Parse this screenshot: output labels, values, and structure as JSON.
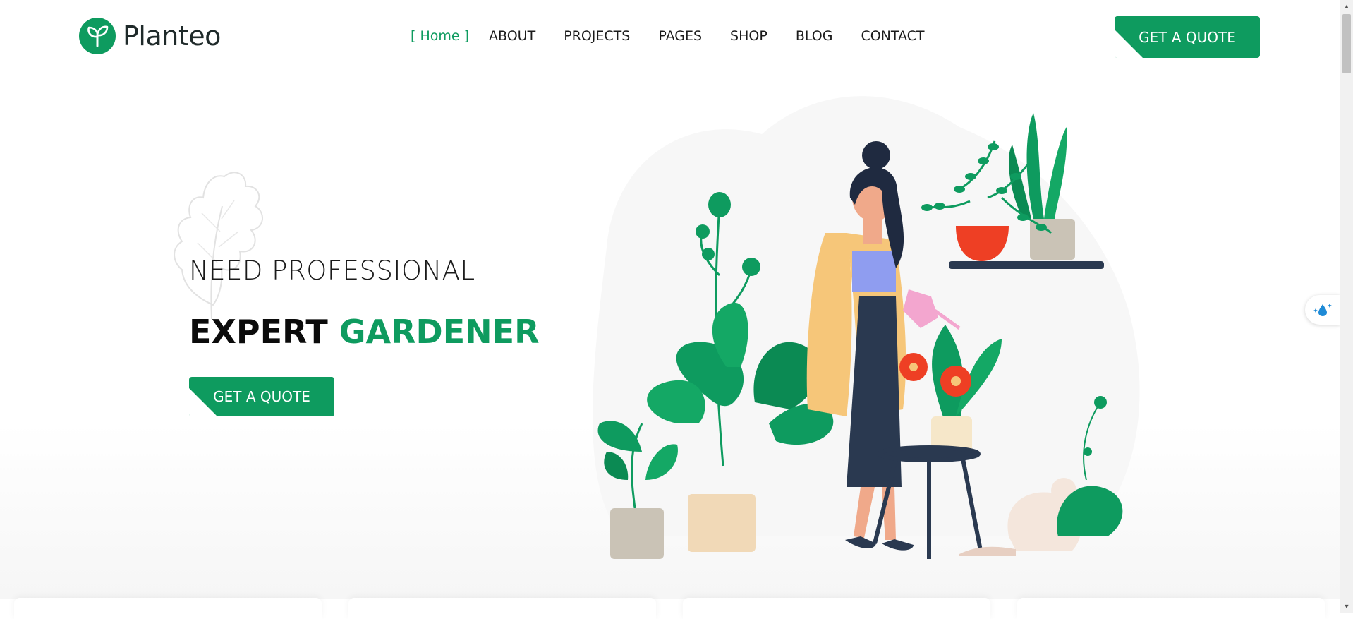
{
  "brand": {
    "name": "Planteo",
    "accent": "#0e9b5f"
  },
  "nav": {
    "items": [
      {
        "label": "[ Home ]",
        "active": true
      },
      {
        "label": "ABOUT"
      },
      {
        "label": "PROJECTS"
      },
      {
        "label": "PAGES"
      },
      {
        "label": "SHOP"
      },
      {
        "label": "BLOG"
      },
      {
        "label": "CONTACT"
      }
    ]
  },
  "header": {
    "quote_label": "GET A QUOTE"
  },
  "hero": {
    "subtitle": "NEED PROFESSIONAL",
    "title_part1": "EXPERT ",
    "title_part2": "GARDENER",
    "cta_label": "GET A QUOTE"
  },
  "widgets": {
    "side_icon": "sparkle-water-drop-icon"
  }
}
